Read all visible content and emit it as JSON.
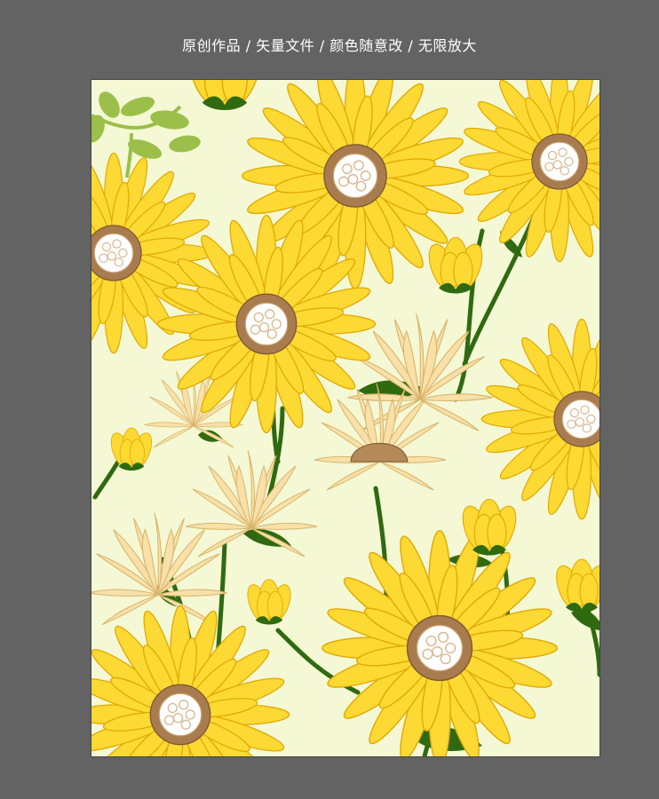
{
  "caption": "原创作品 / 矢量文件 / 颜色随意改 / 无限放大",
  "colors": {
    "window_background": "#636363",
    "artboard_background": "#f4f8d4",
    "petal_yellow": "#fcd933",
    "petal_outline": "#e0a800",
    "petal_cream": "#f8e0a8",
    "stem_green": "#2f6a10",
    "leaf_light_green": "#9bbf48",
    "flower_center": "#a87c4e"
  }
}
